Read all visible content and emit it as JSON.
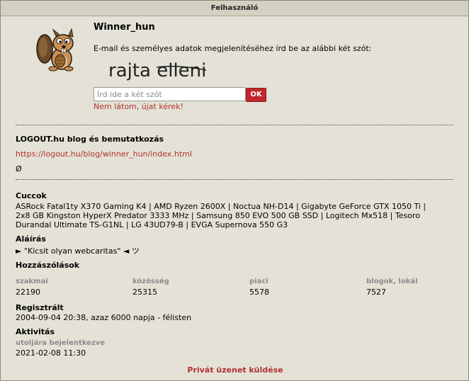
{
  "header": {
    "title": "Felhasználó"
  },
  "profile": {
    "username": "Winner_hun"
  },
  "captcha": {
    "instruction": "E-mail és személyes adatok megjelenítéséhez írd be az alábbi két szót:",
    "image_words": "rajta elleni",
    "placeholder": "Írd ide a két szót",
    "ok_label": "OK",
    "new_link": "Nem látom, újat kérek!"
  },
  "blog": {
    "heading": "LOGOUT.hu blog és bemutatkozás",
    "url": "https://logout.hu/blog/winner_hun/index.html",
    "extra": "Ø"
  },
  "gear": {
    "heading": "Cuccok",
    "line1": "ASRock Fatal1ty X370 Gaming K4 | AMD Ryzen 2600X | Noctua NH-D14 | Gigabyte GeForce GTX 1050 Ti |",
    "line2": "2x8 GB Kingston HyperX Predator 3333 MHz | Samsung 850 EVO 500 GB SSD | Logitech Mx518 | Tesoro",
    "line3": "Durandal Ultimate TS-G1NL | LG 43UD79-B | EVGA Supernova 550 G3"
  },
  "signature": {
    "heading": "Aláírás",
    "text": "► \"Kicsit olyan webcaritas\" ◄ ツ"
  },
  "comments": {
    "heading": "Hozzászólások",
    "stats": [
      {
        "label": "szakmai",
        "value": "22190"
      },
      {
        "label": "közösség",
        "value": "25315"
      },
      {
        "label": "piaci",
        "value": "5578"
      },
      {
        "label": "blogok, lokál",
        "value": "7527"
      }
    ]
  },
  "registered": {
    "heading": "Regisztrált",
    "text": "2004-09-04 20:38, azaz 6000 napja - félisten"
  },
  "activity": {
    "heading": "Aktivitás",
    "sublabel": "utoljára bejelentkezve",
    "last_login": "2021-02-08 11:30"
  },
  "actions": {
    "private_message": "Privát üzenet küldése"
  },
  "colors": {
    "accent": "#b2312f",
    "panel_bg": "#e4e2d7",
    "header_bg": "#d4d0c2",
    "ok_button": "#c1272d"
  }
}
